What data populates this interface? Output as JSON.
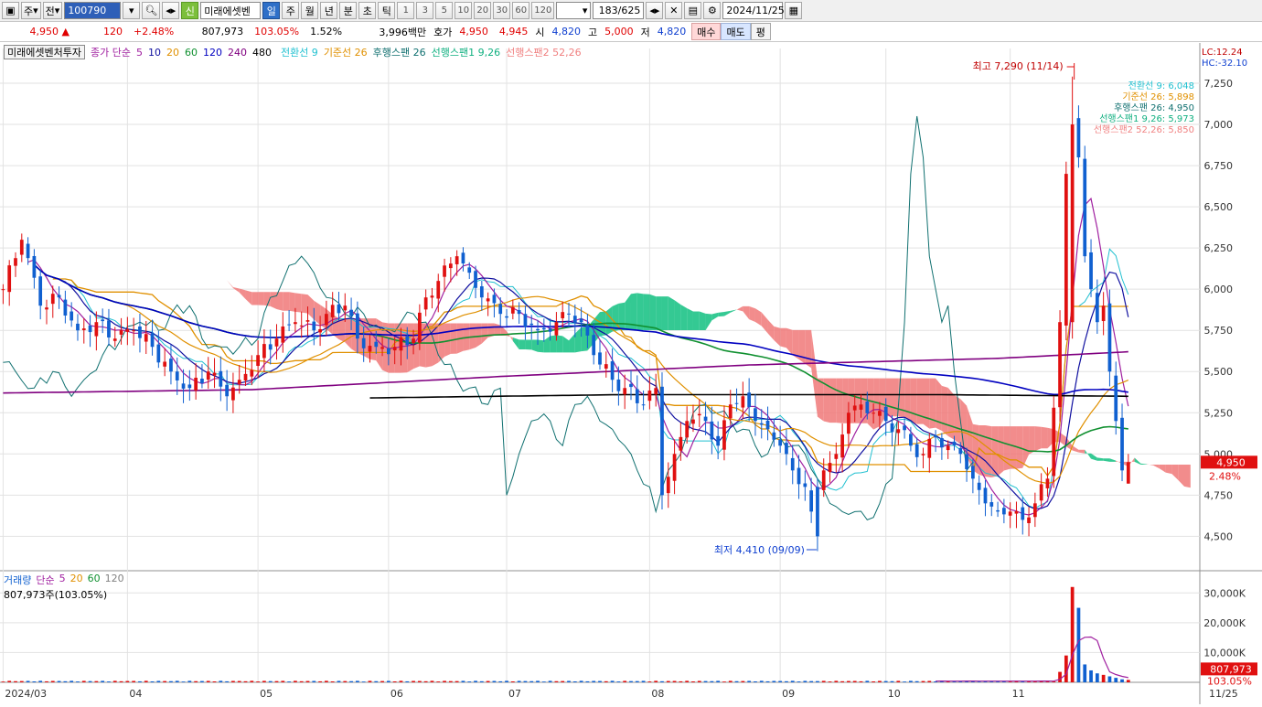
{
  "toolbar": {
    "type_label": "주",
    "mode_label": "전",
    "code": "100790",
    "sin_label": "신",
    "stock_name": "미래에셋벤",
    "periods": [
      "일",
      "주",
      "월",
      "년",
      "분",
      "초",
      "틱"
    ],
    "active_period": "일",
    "intervals": [
      "1",
      "3",
      "5",
      "10",
      "20",
      "30",
      "60",
      "120"
    ],
    "count": "183/625",
    "date": "2024/11/25"
  },
  "quote": {
    "price": "4,950",
    "arrow": "▲",
    "change": "120",
    "change_pct": "+2.48%",
    "volume": "807,973",
    "volume_ratio": "103.05%",
    "turnover": "1.52%",
    "amount": "3,996백만",
    "ask_label": "호가",
    "ask": "4,950",
    "bid": "4,945",
    "open_label": "시",
    "open": "4,820",
    "high_label": "고",
    "high": "5,000",
    "low_label": "저",
    "low": "4,820",
    "buy_label": "매수",
    "sell_label": "매도",
    "eval_label": "평"
  },
  "legend": {
    "stock": "미래에셋벤처투자",
    "ma_title": "종가 단순",
    "ma_periods": [
      {
        "label": "5",
        "color": "#a020a0"
      },
      {
        "label": "10",
        "color": "#1010a0"
      },
      {
        "label": "20",
        "color": "#e09000"
      },
      {
        "label": "60",
        "color": "#109030"
      },
      {
        "label": "120",
        "color": "#0000c0"
      },
      {
        "label": "240",
        "color": "#800080"
      },
      {
        "label": "480",
        "color": "#000000"
      }
    ],
    "ichimoku": [
      {
        "label": "전환선 9",
        "color": "#20c0d0"
      },
      {
        "label": "기준선 26",
        "color": "#e09000"
      },
      {
        "label": "후행스팬 26",
        "color": "#107070"
      },
      {
        "label": "선행스팬1 9,26",
        "color": "#10b080"
      },
      {
        "label": "선행스팬2 52,26",
        "color": "#f08080"
      }
    ],
    "lc": "LC:12.24",
    "hc": "HC:-32.10"
  },
  "right_labels": [
    {
      "text": "전환선 9: 6,048",
      "color": "#20c0d0"
    },
    {
      "text": "기준선 26: 5,898",
      "color": "#e09000"
    },
    {
      "text": "후행스팬 26: 4,950",
      "color": "#107070"
    },
    {
      "text": "선행스팬1 9,26: 5,973",
      "color": "#10b080"
    },
    {
      "text": "선행스팬2 52,26: 5,850",
      "color": "#f08080"
    }
  ],
  "annotations": {
    "high": "최고 7,290 (11/14)",
    "low": "최저 4,410 (09/09)"
  },
  "price_tag": {
    "price": "4,950",
    "pct": "2.48%"
  },
  "volume_legend": {
    "title": "거래량",
    "ma_title": "단순",
    "periods": [
      {
        "label": "5",
        "color": "#a020a0"
      },
      {
        "label": "20",
        "color": "#e09000"
      },
      {
        "label": "60",
        "color": "#109030"
      },
      {
        "label": "120",
        "color": "#808080"
      }
    ],
    "current": "807,973주(103.05%)"
  },
  "volume_tag": {
    "value": "807,973",
    "pct": "103.05%"
  },
  "colors": {
    "up": "#e01010",
    "down": "#1060d0",
    "span1_cloud": "#10c080",
    "span2_cloud": "#f07878"
  },
  "chart_data": {
    "type": "candlestick",
    "y_ticks": [
      4500,
      4750,
      5000,
      5250,
      5500,
      5750,
      6000,
      6250,
      6500,
      6750,
      7000,
      7250
    ],
    "y_tick_labels": [
      "4,500",
      "4,750",
      "5,000",
      "5,250",
      "5,500",
      "5,750",
      "6,000",
      "6,250",
      "6,500",
      "6,750",
      "7,000",
      "7,250"
    ],
    "ylim": [
      4330,
      7350
    ],
    "x_ticks": [
      {
        "label": "2024/03",
        "index": 0
      },
      {
        "label": "04",
        "index": 20
      },
      {
        "label": "05",
        "index": 41
      },
      {
        "label": "06",
        "index": 62
      },
      {
        "label": "07",
        "index": 81
      },
      {
        "label": "08",
        "index": 104
      },
      {
        "label": "09",
        "index": 125
      },
      {
        "label": "10",
        "index": 142
      },
      {
        "label": "11",
        "index": 162
      },
      {
        "label": "11/25",
        "index": 191
      }
    ],
    "n_slots": 193,
    "last_index": 181,
    "anchors": [
      [
        0,
        6000
      ],
      [
        3,
        6300
      ],
      [
        6,
        5900
      ],
      [
        9,
        5950
      ],
      [
        12,
        5750
      ],
      [
        15,
        5800
      ],
      [
        18,
        5700
      ],
      [
        21,
        5750
      ],
      [
        24,
        5650
      ],
      [
        27,
        5500
      ],
      [
        30,
        5400
      ],
      [
        33,
        5500
      ],
      [
        36,
        5350
      ],
      [
        38,
        5450
      ],
      [
        41,
        5600
      ],
      [
        44,
        5700
      ],
      [
        47,
        5800
      ],
      [
        50,
        5750
      ],
      [
        52,
        5850
      ],
      [
        55,
        5900
      ],
      [
        57,
        5700
      ],
      [
        60,
        5650
      ],
      [
        63,
        5650
      ],
      [
        66,
        5700
      ],
      [
        68,
        5950
      ],
      [
        70,
        6050
      ],
      [
        73,
        6200
      ],
      [
        75,
        6100
      ],
      [
        77,
        5950
      ],
      [
        80,
        5850
      ],
      [
        83,
        5850
      ],
      [
        86,
        5750
      ],
      [
        89,
        5800
      ],
      [
        91,
        5850
      ],
      [
        93,
        5800
      ],
      [
        95,
        5600
      ],
      [
        98,
        5450
      ],
      [
        100,
        5400
      ],
      [
        103,
        5300
      ],
      [
        105,
        5400
      ],
      [
        106,
        4750
      ],
      [
        108,
        5000
      ],
      [
        110,
        5200
      ],
      [
        113,
        5200
      ],
      [
        115,
        5050
      ],
      [
        117,
        5300
      ],
      [
        119,
        5350
      ],
      [
        121,
        5200
      ],
      [
        123,
        5150
      ],
      [
        125,
        5050
      ],
      [
        127,
        4900
      ],
      [
        129,
        4800
      ],
      [
        130,
        4650
      ],
      [
        132,
        4900
      ],
      [
        134,
        5000
      ],
      [
        136,
        5250
      ],
      [
        138,
        5300
      ],
      [
        140,
        5250
      ],
      [
        142,
        5200
      ],
      [
        144,
        5150
      ],
      [
        146,
        5050
      ],
      [
        148,
        5000
      ],
      [
        150,
        5100
      ],
      [
        152,
        5050
      ],
      [
        154,
        5000
      ],
      [
        156,
        4850
      ],
      [
        158,
        4700
      ],
      [
        160,
        4650
      ],
      [
        162,
        4650
      ],
      [
        164,
        4600
      ],
      [
        166,
        4700
      ],
      [
        168,
        4850
      ],
      [
        170,
        5800
      ],
      [
        171,
        6700
      ],
      [
        172,
        7050
      ],
      [
        173,
        6800
      ],
      [
        174,
        6200
      ],
      [
        175,
        6000
      ],
      [
        176,
        5800
      ],
      [
        177,
        5900
      ],
      [
        178,
        5500
      ],
      [
        179,
        5200
      ],
      [
        180,
        4900
      ],
      [
        181,
        4950
      ]
    ],
    "special_candles": [
      {
        "index": 172,
        "open": 5800,
        "close": 7000,
        "high": 7290,
        "low": 5700
      },
      {
        "index": 131,
        "open": 4800,
        "close": 4500,
        "high": 4850,
        "low": 4410
      },
      {
        "index": 181,
        "open": 4820,
        "close": 4950,
        "high": 5000,
        "low": 4820
      }
    ],
    "ma_lines": [
      {
        "name": "5",
        "color": "#a020a0",
        "period": 5
      },
      {
        "name": "10",
        "color": "#1010a0",
        "period": 10
      },
      {
        "name": "20",
        "color": "#e09000",
        "period": 20
      },
      {
        "name": "60",
        "color": "#109030",
        "period": 60
      },
      {
        "name": "120",
        "color": "#0000c0",
        "period": 120
      },
      {
        "name": "240",
        "color": "#800080",
        "points": [
          [
            0,
            5370
          ],
          [
            40,
            5390
          ],
          [
            80,
            5470
          ],
          [
            120,
            5540
          ],
          [
            160,
            5580
          ],
          [
            181,
            5620
          ]
        ]
      },
      {
        "name": "480",
        "color": "#000000",
        "points": [
          [
            59,
            5340
          ],
          [
            100,
            5360
          ],
          [
            150,
            5360
          ],
          [
            181,
            5350
          ]
        ]
      }
    ],
    "volume": {
      "ylim": [
        0,
        35000
      ],
      "y_ticks": [
        10000,
        20000,
        30000
      ],
      "y_tick_labels": [
        "10,000K",
        "20,000K",
        "30,000K"
      ],
      "spikes": [
        [
          170,
          3500
        ],
        [
          171,
          9000
        ],
        [
          172,
          32000
        ],
        [
          173,
          25000
        ],
        [
          174,
          6000
        ],
        [
          175,
          4000
        ],
        [
          176,
          3000
        ],
        [
          177,
          2500
        ],
        [
          178,
          2000
        ],
        [
          179,
          1500
        ],
        [
          180,
          1000
        ],
        [
          181,
          808
        ]
      ],
      "base": 250
    }
  }
}
